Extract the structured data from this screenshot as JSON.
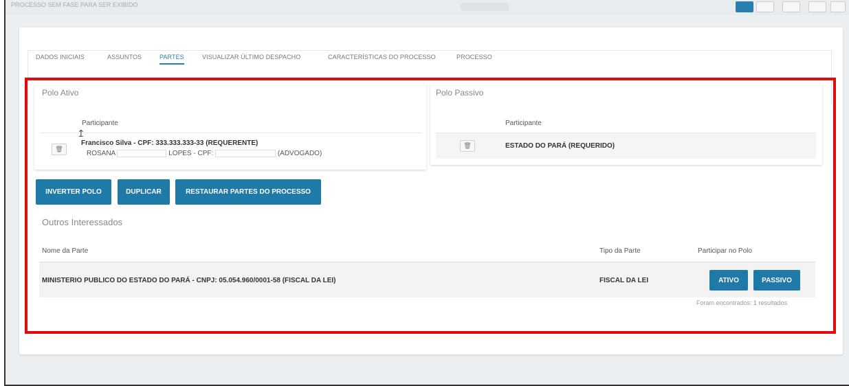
{
  "topbar": {
    "crumb": "PROCESSO SEM FASE PARA SER EXIBIDO"
  },
  "tabs": [
    {
      "label": "DADOS INICIAIS"
    },
    {
      "label": "ASSUNTOS"
    },
    {
      "label": "PARTES",
      "active": true
    },
    {
      "label": "VISUALIZAR ÚLTIMO DESPACHO"
    },
    {
      "label": "CARACTERÍSTICAS DO PROCESSO"
    },
    {
      "label": "PROCESSO"
    }
  ],
  "polo_ativo": {
    "title": "Polo Ativo",
    "column": "Participante",
    "party_main": "Francisco Silva - CPF: 333.333.333-33 (REQUERENTE)",
    "party_sub_prefix": "ROSANA",
    "party_sub_middle": "LOPES - CPF:",
    "party_sub_suffix": "(ADVOGADO)"
  },
  "polo_passivo": {
    "title": "Polo Passivo",
    "column": "Participante",
    "party_main": "ESTADO DO PARÁ (REQUERIDO)"
  },
  "actions": {
    "inverter": "INVERTER POLO",
    "duplicar": "DUPLICAR",
    "restaurar": "RESTAURAR PARTES DO PROCESSO"
  },
  "outros": {
    "title": "Outros Interessados",
    "columns": {
      "nome": "Nome da Parte",
      "tipo": "Tipo da Parte",
      "participar": "Participar no Polo"
    },
    "rows": [
      {
        "nome": "MINISTERIO PUBLICO DO ESTADO DO PARÁ - CNPJ: 05.054.960/0001-58 (FISCAL DA LEI)",
        "tipo": "FISCAL DA LEI",
        "btn_ativo": "ATIVO",
        "btn_passivo": "PASSIVO"
      }
    ],
    "result_count": "Foram encontrados: 1 resultados"
  },
  "colors": {
    "primary": "#1f7aa8",
    "highlight_border": "#e00b0b",
    "active_tab": "#2a7fb0"
  }
}
